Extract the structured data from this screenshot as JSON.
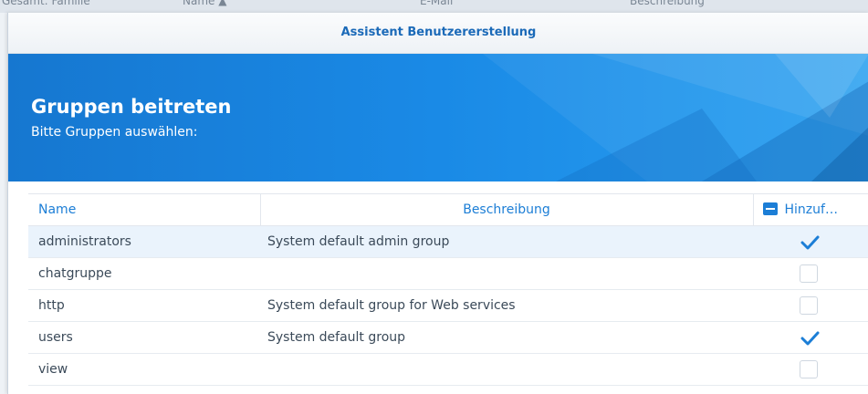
{
  "background": {
    "fragments": [
      "Gesamt: Familie",
      "Name ▲",
      "E-Mail",
      "Beschreibung"
    ]
  },
  "dialog": {
    "title": "Assistent Benutzererstellung"
  },
  "banner": {
    "title": "Gruppen beitreten",
    "subtitle": "Bitte Gruppen auswählen:"
  },
  "table": {
    "columns": [
      "Name",
      "Beschreibung",
      "Hinzuf…"
    ],
    "rows": [
      {
        "name": "administrators",
        "description": "System default admin group",
        "checked": true,
        "selected": true
      },
      {
        "name": "chatgruppe",
        "description": "",
        "checked": false,
        "selected": false
      },
      {
        "name": "http",
        "description": "System default group for Web services",
        "checked": false,
        "selected": false
      },
      {
        "name": "users",
        "description": "System default group",
        "checked": true,
        "selected": false
      },
      {
        "name": "view",
        "description": "",
        "checked": false,
        "selected": false
      }
    ]
  },
  "colors": {
    "accent": "#1c7ed6",
    "banner": "#1a8ae6",
    "check": "#1c7ed6"
  }
}
